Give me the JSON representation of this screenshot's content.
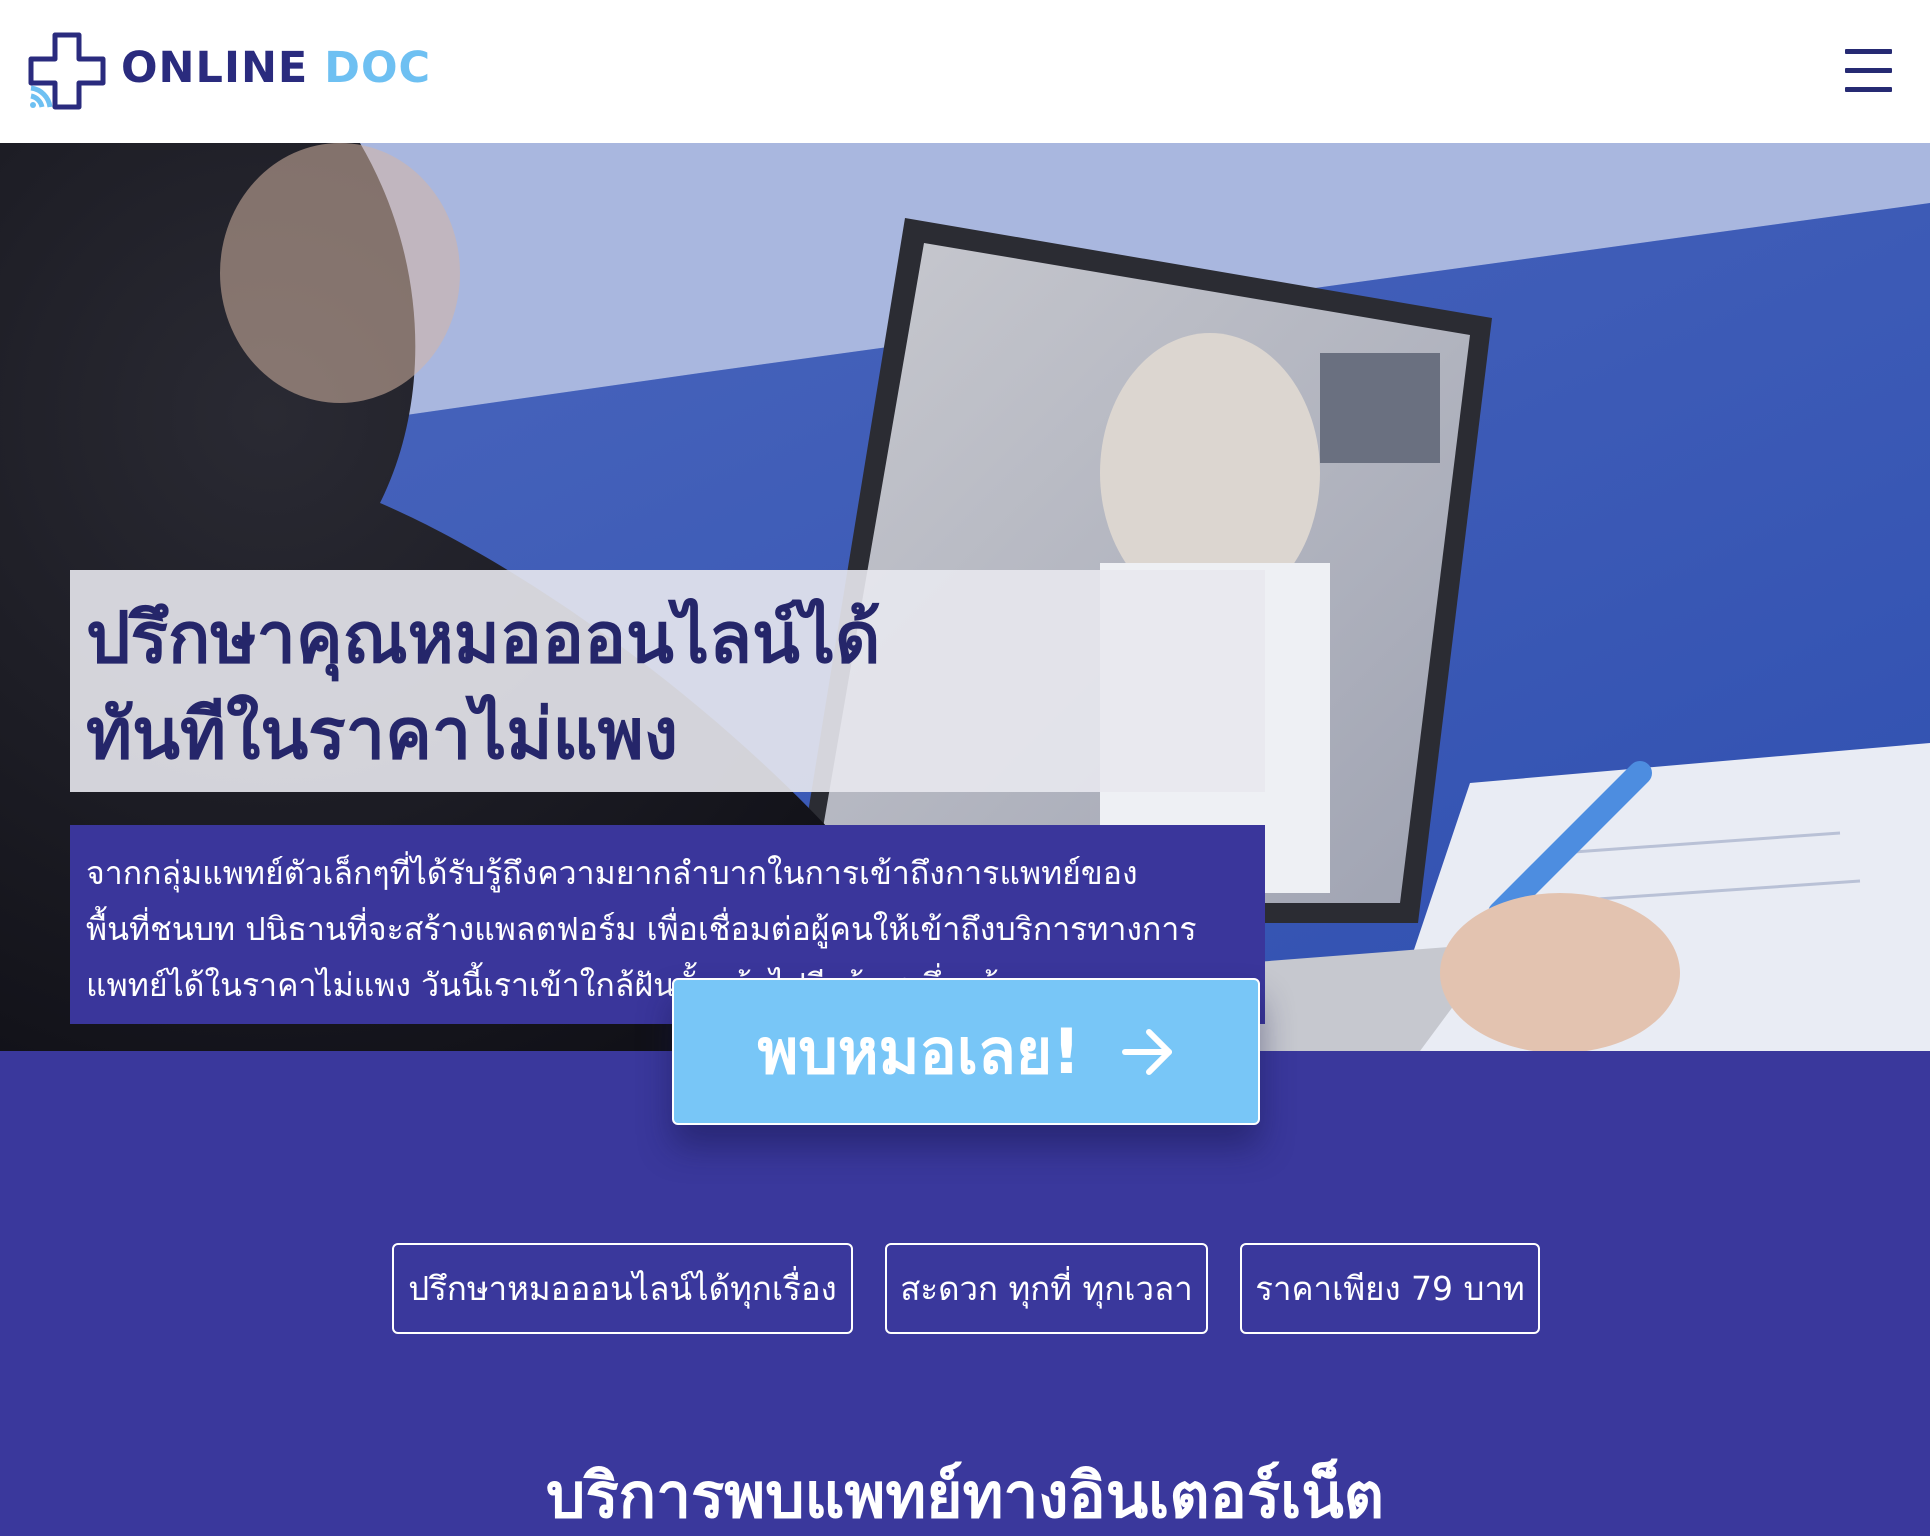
{
  "header": {
    "logo": {
      "online": "ONLINE",
      "doc": "DOC"
    },
    "menu_icon": "hamburger-menu-icon"
  },
  "hero": {
    "headline_line1": "ปรึกษาคุณหมอออนไลน์ได้",
    "headline_line2": "ทันทีในราคาไม่แพง",
    "description_line1": "จากกลุ่มแพทย์ตัวเล็กๆที่ได้รับรู้ถึงความยากลำบากในการเข้าถึงการแพทย์ของ",
    "description_line2": "พื้นที่ชนบท ปนิธานที่จะสร้างแพลตฟอร์ม เพื่อเชื่อมต่อผู้คนให้เข้าถึงบริการทางการ",
    "description_line3": "แพทย์ได้ในราคาไม่แพง วันนี้เราเข้าใกล้ฝันนั้นเข้าไปอีกก้าวหนึ่งแล้ว"
  },
  "cta": {
    "label": "พบหมอเลย!",
    "icon": "arrow-right-icon"
  },
  "features": [
    {
      "label": "ปรึกษาหมอออนไลน์ได้ทุกเรื่อง"
    },
    {
      "label": "สะดวก ทุกที่ ทุกเวลา"
    },
    {
      "label": "ราคาเพียง 79 บาท"
    }
  ],
  "section": {
    "title": "บริการพบแพทย์ทางอินเตอร์เน็ต"
  },
  "colors": {
    "primary": "#3a389c",
    "brand_dark": "#2a2b7e",
    "brand_light": "#6ec0f2",
    "cta": "#78c6f7",
    "headline_bg": "#e8e8ee"
  }
}
